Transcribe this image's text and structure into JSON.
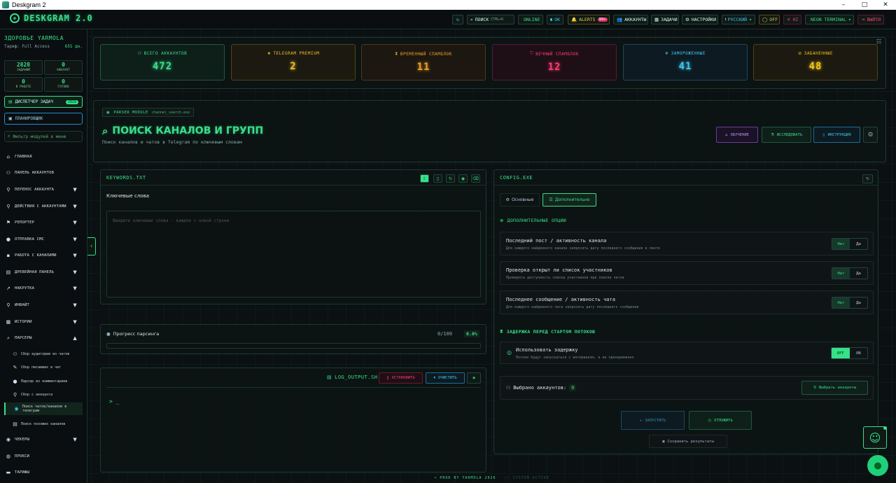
{
  "window": {
    "title": "Deskgram 2",
    "minimize": "–",
    "maximize": "□",
    "close": "✕"
  },
  "topbar": {
    "logo": "DESKGRAM 2.0",
    "refresh_icon": "refresh-icon",
    "search_label": "ПОИСК",
    "search_shortcut": "CTRL+K",
    "online": "ONLINE",
    "ok": "OK",
    "alerts": "ALERTS",
    "alerts_badge": "99+",
    "accounts": "АККАУНТЫ",
    "tasks": "ЗАДАЧИ",
    "settings": "НАСТРОЙКИ",
    "language": "РУССКИЙ",
    "off": "OFF",
    "hz": "HZ",
    "theme": "NEON TERMINAL",
    "logout": "ВЫЙТИ"
  },
  "sidebar": {
    "user_name": "ЗДОРОВЬЕ YARMOLA",
    "tariff": "Тариф: Full Access",
    "days": "655 дн.",
    "stats": [
      {
        "value": "2828",
        "label": "ЗАДАНИЙ"
      },
      {
        "value": "0",
        "label": "АККАУНТ"
      },
      {
        "value": "0",
        "label": "В РАБОТЕ"
      },
      {
        "value": "0",
        "label": "ГОТОВО"
      }
    ],
    "dispatcher": "ДИСПЕТЧЕР ЗАДАЧ",
    "dispatcher_badge": "2828",
    "planner": "ПЛАНИРОВЩИК",
    "filter_placeholder": "Фильтр модулей в меню",
    "items": [
      {
        "label": "ГЛАВНАЯ",
        "icon": "home-icon"
      },
      {
        "label": "ПАНЕЛЬ АККАУНТОВ",
        "icon": "users-icon"
      },
      {
        "label": "ПЕРЕНОС АККАУНТА",
        "icon": "user-transfer-icon"
      },
      {
        "label": "ДЕЙСТВИЯ С АККАУНТАМИ",
        "icon": "user-action-icon"
      },
      {
        "label": "РЕПОРТЕР",
        "icon": "flag-icon"
      },
      {
        "label": "ОТПРАВКА СМС",
        "icon": "chat-icon"
      },
      {
        "label": "РАБОТА С КАНАЛАМИ",
        "icon": "channel-icon"
      },
      {
        "label": "ДРЕВЕЙНАЯ ПАНЕЛЬ",
        "icon": "panel-icon"
      },
      {
        "label": "НАКРУТКА",
        "icon": "chart-icon"
      },
      {
        "label": "ИНВАЙТ",
        "icon": "invite-icon"
      },
      {
        "label": "ИСТОРИИ",
        "icon": "stories-icon"
      },
      {
        "label": "ПАРСЕРЫ",
        "icon": "search-icon"
      }
    ],
    "sub_items": [
      {
        "label": "Сбор аудитории из чатов",
        "icon": "group-icon"
      },
      {
        "label": "Сбор писавших в чат",
        "icon": "pen-icon"
      },
      {
        "label": "Парсер из комментариев",
        "icon": "comment-icon"
      },
      {
        "label": "Сбор с аккаунта",
        "icon": "user-icon"
      },
      {
        "label": "Поиск чатов/каналов в телеграм",
        "icon": "telegram-icon"
      },
      {
        "label": "Поиск похожих каналов",
        "icon": "database-icon"
      }
    ],
    "bottom_items": [
      {
        "label": "ЧЕКЕРЫ",
        "icon": "check-icon"
      },
      {
        "label": "ПРОКСИ",
        "icon": "globe-icon"
      },
      {
        "label": "ТАРИФЫ",
        "icon": "tariff-icon"
      }
    ]
  },
  "kpis": [
    {
      "label": "ВСЕГО АККАУНТОВ",
      "value": "472",
      "color": "#37e08a",
      "icon": "users-icon"
    },
    {
      "label": "TELEGRAM PREMIUM",
      "value": "2",
      "color": "#f2c12e",
      "icon": "star-icon"
    },
    {
      "label": "ВРЕМЕННЫЙ СПАМБЛОК",
      "value": "11",
      "color": "#f0a02a",
      "icon": "hourglass-icon"
    },
    {
      "label": "ВЕЧНЫЙ СПАМБЛОК",
      "value": "12",
      "color": "#ff3b6e",
      "icon": "shield-icon"
    },
    {
      "label": "ЗАМОРОЖЕННЫЕ",
      "value": "41",
      "color": "#3cc8ef",
      "icon": "snowflake-icon"
    },
    {
      "label": "ЗАБАНЕННЫЕ",
      "value": "48",
      "color": "#f5c518",
      "icon": "ban-icon"
    }
  ],
  "header": {
    "module_tag": "PARSER MODULE",
    "module_file": "channel_search.exe",
    "title": "ПОИСК КАНАЛОВ И ГРУПП",
    "subtitle": "Поиск каналов и чатов в Telegram по ключевым словам",
    "btn_learn": "ОБУЧЕНИЕ",
    "btn_research": "ИССЛЕДОВАТЬ",
    "btn_instruction": "ИНСТРУКЦИЯ"
  },
  "keywords": {
    "file": "KEYWORDS.TXT",
    "label": "Ключевые слова",
    "placeholder": "Введите ключевые слова - каждое с новой строки"
  },
  "progress": {
    "label": "Прогресс парсинга",
    "count": "0/100",
    "percent": "0.0%",
    "fraction": 0.0
  },
  "log": {
    "file": "LOG_OUTPUT.SH",
    "stop": "ОСТАНОВИТЬ",
    "clear": "ОЧИСТИТЬ",
    "prompt": "> _"
  },
  "config": {
    "file": "CONFIG.EXE",
    "tab_basic": "Основные",
    "tab_advanced": "Дополнительно",
    "section_options": "ДОПОЛНИТЕЛЬНЫЕ ОПЦИИ",
    "options": [
      {
        "title": "Последний пост / активность канала",
        "desc": "Для каждого найденного канала запросить дату последнего сообщения в ленте",
        "no": "Нет",
        "yes": "Да"
      },
      {
        "title": "Проверка открыт ли список участников",
        "desc": "Проверять доступность списка участников при поиске чатов",
        "no": "Нет",
        "yes": "Да"
      },
      {
        "title": "Последнее сообщение / активность чата",
        "desc": "Для каждого найденного чата запросить дату последнего сообщения",
        "no": "Нет",
        "yes": "Да"
      }
    ],
    "section_delay": "ЗАДЕРЖКА ПЕРЕД СТАРТОМ ПОТОКОВ",
    "delay_title": "Использовать задержку",
    "delay_desc": "Потоки будут запускаться с интервалом, а не одновременно",
    "delay_off": "OFF",
    "delay_on": "ON",
    "selected_label": "Выбрано аккаунтов:",
    "selected_count": "0",
    "select_btn": "Выбрать аккаунты",
    "start": "ЗАПУСТИТЬ",
    "postpone": "ОТЛОЖИТЬ",
    "save": "Сохранить результаты"
  },
  "footer": {
    "left": "• PROD BY YARMOLA 2026",
    "right": "// SYSTEM ACTIVE"
  }
}
